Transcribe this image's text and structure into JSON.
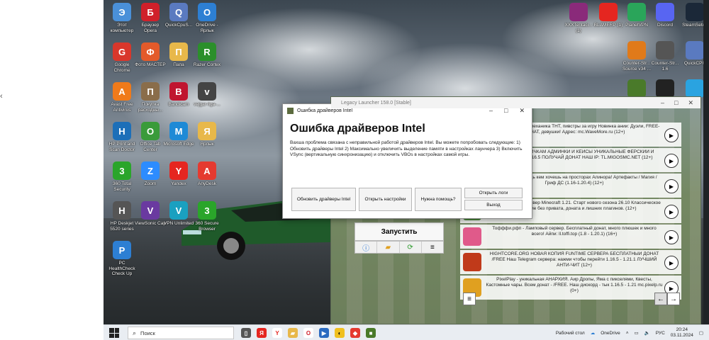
{
  "stray_glyph": "‹",
  "desktop_icons": [
    {
      "label": "Этот компьютер",
      "icon": "computer-icon",
      "color": "#4a90d9"
    },
    {
      "label": "Браузер Opera",
      "icon": "opera-icon",
      "color": "#d0202a"
    },
    {
      "label": "QuickCpuS...",
      "icon": "quickcpu-icon",
      "color": "#5a7ac0"
    },
    {
      "label": "OneDrive - Ярлык",
      "icon": "onedrive-icon",
      "color": "#2d7fd3"
    },
    {
      "label": "Google Chrome",
      "icon": "chrome-icon",
      "color": "#d9372b"
    },
    {
      "label": "Фото МАСТЕР",
      "icon": "photomaster-icon",
      "color": "#e35a2a"
    },
    {
      "label": "Папа",
      "icon": "folder-icon",
      "color": "#e8b84a"
    },
    {
      "label": "Razer Cortex",
      "icon": "razer-icon",
      "color": "#2b8f2b"
    },
    {
      "label": "Avast Free Antivirus",
      "icon": "avast-icon",
      "color": "#f07a1a"
    },
    {
      "label": "Покупка расходны...",
      "icon": "shopping-icon",
      "color": "#8a6d4a"
    },
    {
      "label": "Bandicam",
      "icon": "bandicam-icon",
      "color": "#c0152f"
    },
    {
      "label": "vejgar-liga-...",
      "icon": "video-file-icon",
      "color": "#444444"
    },
    {
      "label": "HP Print and Scan Doctor",
      "icon": "hp-doctor-icon",
      "color": "#1d6fb8"
    },
    {
      "label": "Office Tab Center",
      "icon": "officetab-icon",
      "color": "#3a9b3a"
    },
    {
      "label": "Microsoft Edge",
      "icon": "edge-icon",
      "color": "#1e8ad6"
    },
    {
      "label": "Ярлык",
      "icon": "folder-shortcut-icon",
      "color": "#e8b84a"
    },
    {
      "label": "360 Total Security",
      "icon": "360-icon",
      "color": "#2aa52a"
    },
    {
      "label": "Zoom",
      "icon": "zoom-icon",
      "color": "#2d8cff"
    },
    {
      "label": "Yandex",
      "icon": "yandex-icon",
      "color": "#e52620"
    },
    {
      "label": "AnyDesk",
      "icon": "anydesk-icon",
      "color": "#e53a30"
    },
    {
      "label": "HP Deskjet 5520 series",
      "icon": "printer-icon",
      "color": "#555555"
    },
    {
      "label": "ViewSonic Cap",
      "icon": "viewsonic-icon",
      "color": "#6a3aa0"
    },
    {
      "label": "VPN Unlimited",
      "icon": "vpn-icon",
      "color": "#1aa0c0"
    },
    {
      "label": "360 Secure Browser",
      "icon": "360-browser-icon",
      "color": "#2aa52a"
    },
    {
      "label": "PC HealthCheck Check Up",
      "icon": "healthcheck-icon",
      "color": "#2d7fd3"
    }
  ],
  "right_icons": [
    {
      "label": "XXXTentaci... (1)",
      "icon": "winrar-icon",
      "color": "#8a2a7a"
    },
    {
      "label": "BLAMERP (1)",
      "icon": "yandex-icon",
      "color": "#e52620"
    },
    {
      "label": "PlanetVPN",
      "icon": "planetvpn-icon",
      "color": "#2aa55a"
    },
    {
      "label": "Discord",
      "icon": "discord-icon",
      "color": "#5865f2"
    },
    {
      "label": "SteamSetup",
      "icon": "steam-icon",
      "color": "#1b2838"
    },
    {
      "label": "Counter-Str... Source v34 ...",
      "icon": "css-icon",
      "color": "#e07a1a"
    },
    {
      "label": "Counter-Str... 1.6",
      "icon": "cs16-icon",
      "color": "#555555"
    },
    {
      "label": "QuickCPU",
      "icon": "quickcpu-icon",
      "color": "#5a7ac0"
    },
    {
      "label": "",
      "icon": "minecraft-icon",
      "color": "#4a7a2a"
    },
    {
      "label": "",
      "icon": "nfs-icon",
      "color": "#222222"
    },
    {
      "label": "",
      "icon": "telegram-icon",
      "color": "#2aa3e0"
    }
  ],
  "launcher": {
    "title": "Legacy Launcher 158.0 [Stable]",
    "run_button": "Запустить",
    "servers": [
      {
        "text": "ф / Квесты, кланы, механика ТНТ, пивстры за игру Новинка ании: Дуэли, FREE-ДОНАТ, девушки! Адрес: mc.WaveMore.ru (12+)",
        "color": "#3a7ad0"
      },
      {
        "text": "ТП С FREE НОВИЧКАМ АДМИНКИ И КЕЙСЫ УНИКАЛЬНЫЕ ФЕРСКИЙ И ВЫЖИВАНИЕ 1.16.5 ПОЛУЧАЙ ДОНАТ НАШ IP: TL.MIGOSMC.NET (12+)",
        "color": "#8a2a2a"
      },
      {
        "text": "м изучи магию, будь кем хочешь на просторах Алинора! Артефакты / Магия / Гриф ДС (1.16-1.20.4) (12+)",
        "color": "#6a4aa0"
      },
      {
        "text": "VANILLA SQUAD сервер Minecraft 1.21. Старт нового сезона 26.10 Классическое выживание без привата, доната и лишних плагинов. (12+)",
        "color": "#4a8a3a"
      },
      {
        "text": "Тофффи.рфп - Ламповый сервер. Бесплатный донат, много плюшек и много всего! Айпи: ll.toffi.top (1.8 - 1.20.1) (16+)",
        "color": "#e05a8a"
      },
      {
        "text": "HIGHTCORE.ORG НОВАЯ КОПИЯ FUNTIME СЕРВЕРА БЕСПЛАТНЫЙ ДОНАТ /FREE Наш Telegram сервера: нажми чтобы перейти 1.16.5 - 1.21.1 ЛУЧШИЙ АНТИ-ЧИТ (12+)",
        "color": "#c03a1a"
      },
      {
        "text": "PixelPlay - уникальная АНАРХИЯ. Аир Дропы, Яма с пикселями, Квесты, Кастомные чары. Всем донат - /FREE. Наш дискорд - тык 1.16.5 - 1.21 mc.pixelp.ru (0+)",
        "color": "#e0a020"
      }
    ],
    "toolbar_icons": [
      "info-icon",
      "folder-icon",
      "refresh-icon",
      "menu-icon"
    ]
  },
  "dialog": {
    "title": "Ошибка драйверов Intel",
    "heading": "Ошибка драйверов Intel",
    "body": "Вахша проблема связана с неправильной работой драйверов Intel. Вы можете попробовать следующие: 1) Обновить драйверы Intel 2) Максимально увеличить выделение памяти в настройках лаунчера 3) Включить VSync (вертикальную синхронизацию) и отключить VBOs в настройках самой игры.",
    "buttons": {
      "update": "Обновить драйверы Intel",
      "settings": "Открыть настройки",
      "help": "Нужна помощь?",
      "logs": "Открыть логи",
      "exit": "Выход"
    }
  },
  "taskbar": {
    "search_placeholder": "Поиск",
    "desktop_label": "Рабочий стол",
    "onedrive_label": "OneDrive",
    "lang": "РУС",
    "time": "20:24",
    "date": "03.11.2024"
  }
}
